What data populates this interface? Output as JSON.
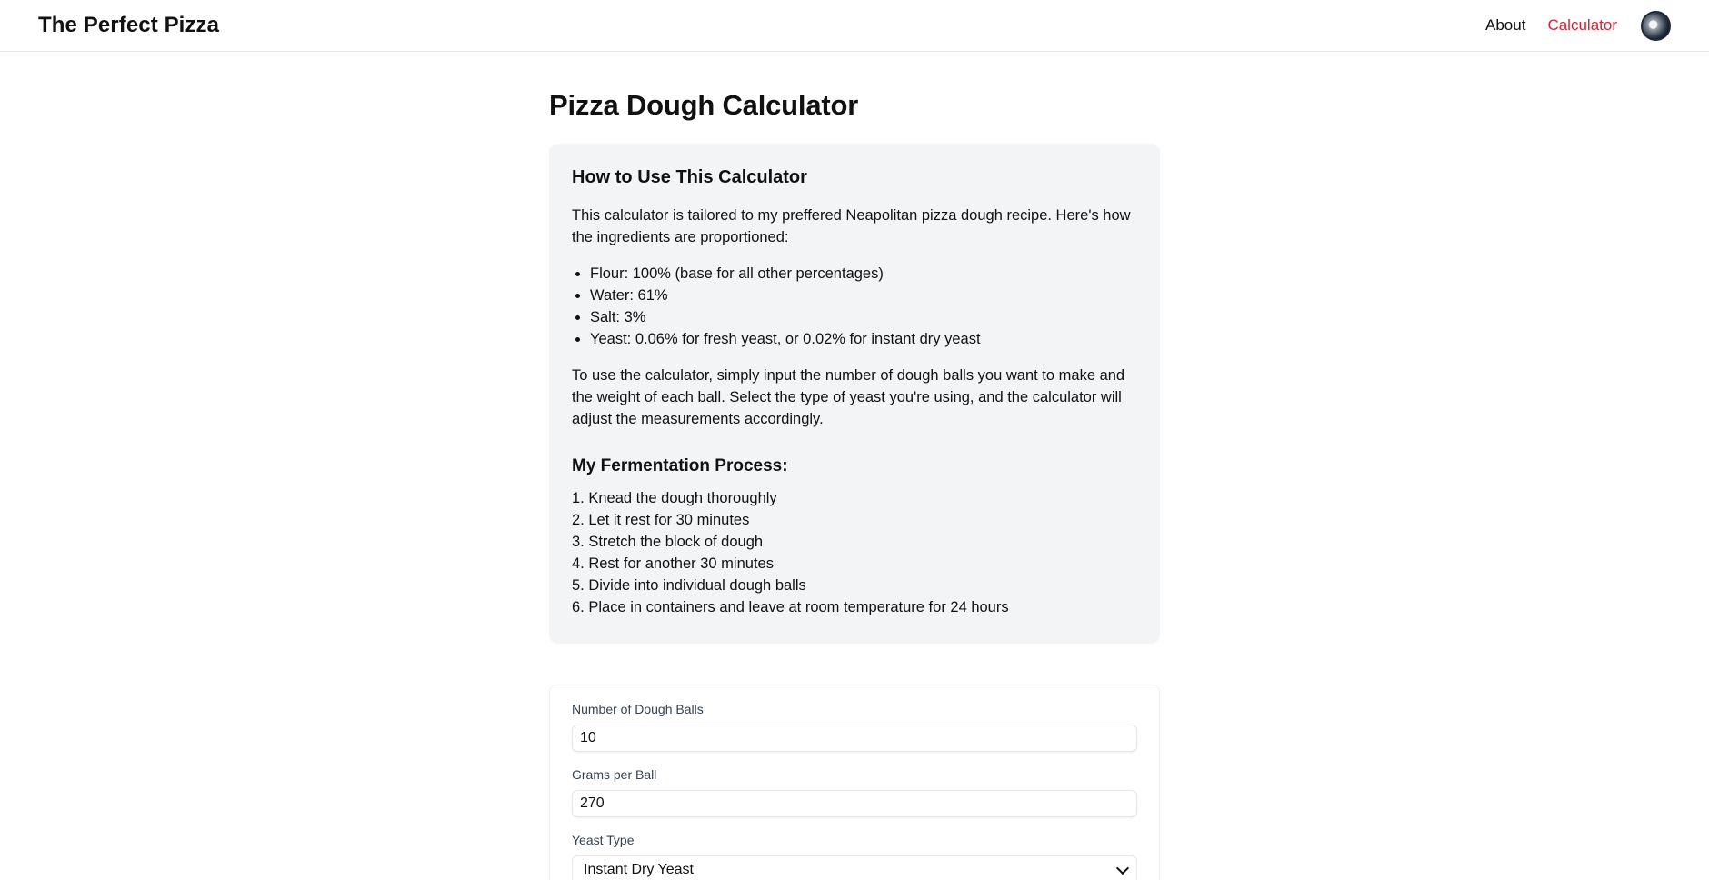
{
  "header": {
    "brand": "The Perfect Pizza",
    "nav": [
      {
        "label": "About",
        "active": false
      },
      {
        "label": "Calculator",
        "active": true
      }
    ],
    "accent_color": "#e11d2e",
    "avatar_icon": "user-avatar"
  },
  "page": {
    "title": "Pizza Dough Calculator"
  },
  "info": {
    "heading": "How to Use This Calculator",
    "intro": "This calculator is tailored to my preffered Neapolitan pizza dough recipe. Here's how the ingredients are proportioned:",
    "ingredients": [
      "Flour: 100% (base for all other percentages)",
      "Water: 61%",
      "Salt: 3%",
      "Yeast: 0.06% for fresh yeast, or 0.02% for instant dry yeast"
    ],
    "usage": "To use the calculator, simply input the number of dough balls you want to make and the weight of each ball. Select the type of yeast you're using, and the calculator will adjust the measurements accordingly.",
    "process_heading": "My Fermentation Process:",
    "steps": [
      "1. Knead the dough thoroughly",
      "2. Let it rest for 30 minutes",
      "3. Stretch the block of dough",
      "4. Rest for another 30 minutes",
      "5. Divide into individual dough balls",
      "6. Place in containers and leave at room temperature for 24 hours"
    ]
  },
  "form": {
    "balls_label": "Number of Dough Balls",
    "balls_value": "10",
    "grams_label": "Grams per Ball",
    "grams_value": "270",
    "yeast_label": "Yeast Type",
    "yeast_value": "Instant Dry Yeast"
  }
}
